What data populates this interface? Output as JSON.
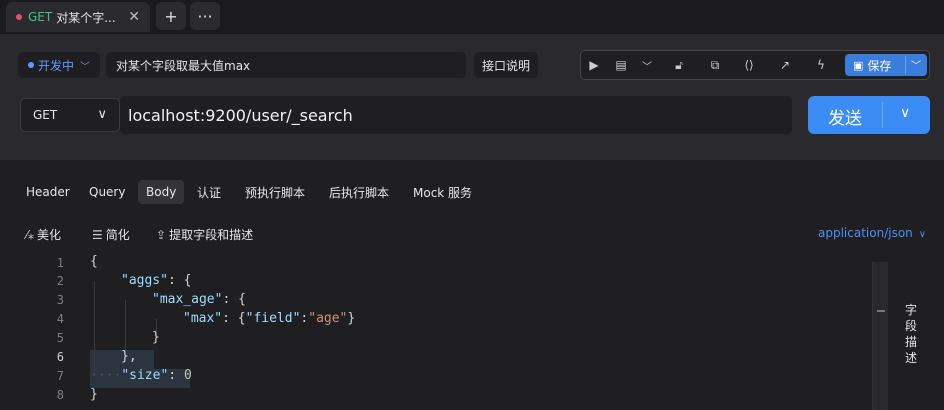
{
  "tabbar": {
    "tab": {
      "method": "GET",
      "title": "对某个字...",
      "close": "✕"
    },
    "add_label": "+",
    "more_label": "···"
  },
  "request": {
    "status": "开发中",
    "name": "对某个字段取最大值max",
    "doc_label": "接口说明",
    "save_label": "保存",
    "method": "GET",
    "url": "localhost:9200/user/_search",
    "send_label": "发送"
  },
  "subtabs": [
    "Header",
    "Query",
    "Body",
    "认证",
    "预执行脚本",
    "后执行脚本",
    "Mock 服务"
  ],
  "actions": {
    "beautify": "美化",
    "simplify": "简化",
    "extract": "提取字段和描述",
    "content_type": "application/json"
  },
  "editor": {
    "line_numbers": [
      "1",
      "2",
      "3",
      "4",
      "5",
      "6",
      "7",
      "8"
    ],
    "aggs_key": "\"aggs\"",
    "max_age_key": "\"max_age\"",
    "max_key": "\"max\"",
    "field_key": "\"field\"",
    "age_value": "\"age\"",
    "size_key": "\"size\"",
    "size_value": "0"
  },
  "side_tab": [
    "字",
    "段",
    "描",
    "述"
  ],
  "colors": {
    "accent": "#3b8cf5",
    "method_get": "#3ec48a",
    "status": "#5b9cff"
  }
}
